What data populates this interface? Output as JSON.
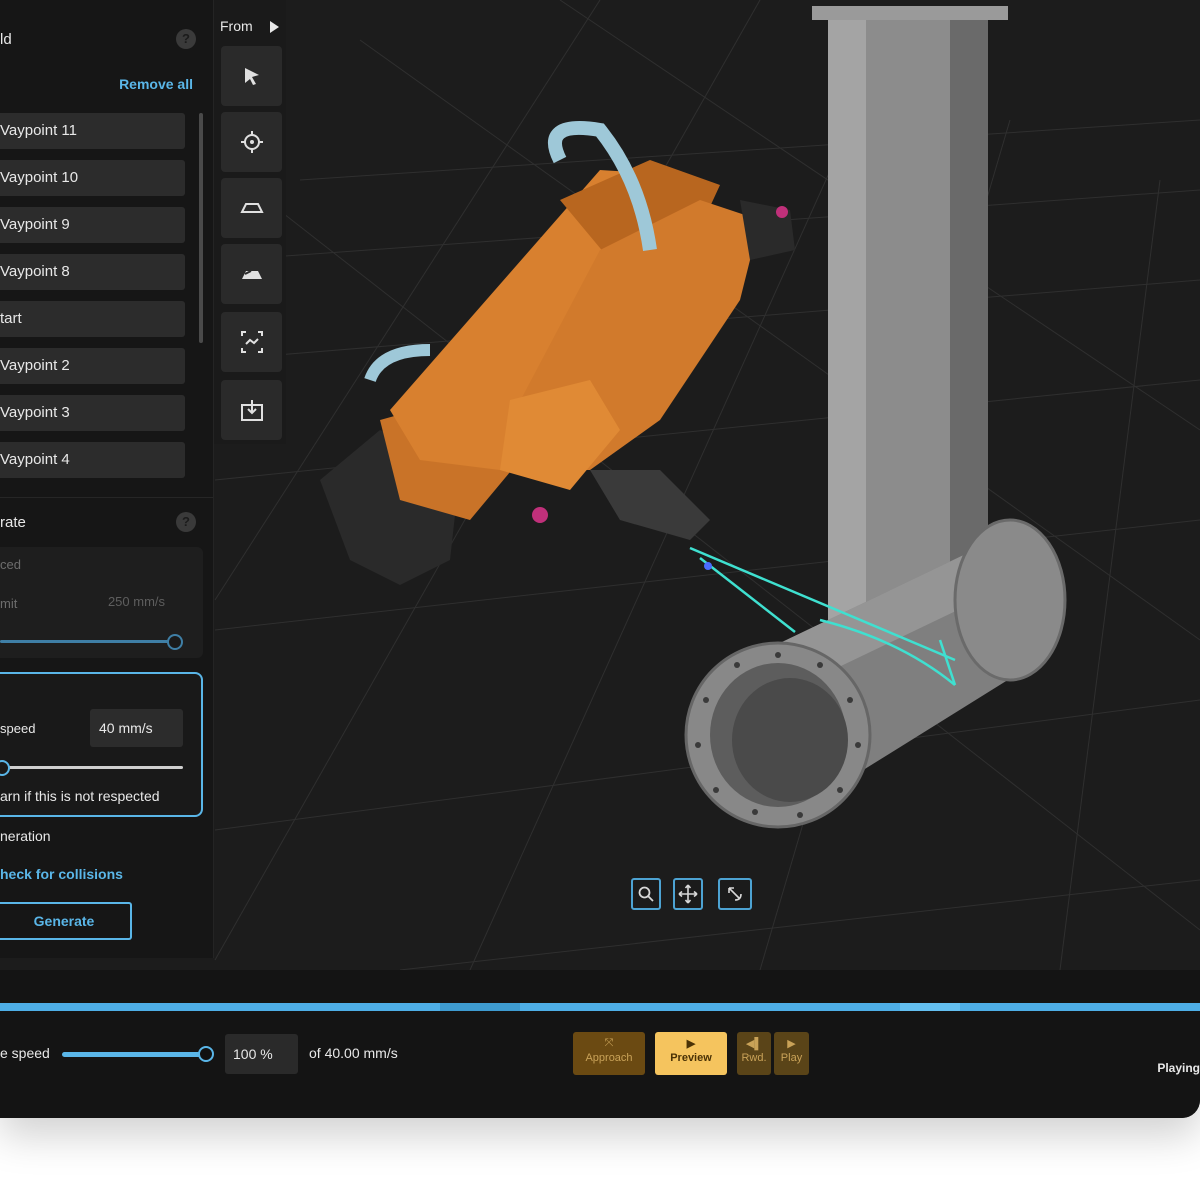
{
  "left_panel": {
    "path_section_title": "ld",
    "remove_all_label": "Remove all",
    "waypoints": [
      {
        "label": "Vaypoint 11"
      },
      {
        "label": "Vaypoint 10"
      },
      {
        "label": "Vaypoint 9"
      },
      {
        "label": "Vaypoint 8"
      },
      {
        "label": "tart"
      },
      {
        "label": "Vaypoint 2"
      },
      {
        "label": "Vaypoint 3"
      },
      {
        "label": "Vaypoint 4"
      }
    ],
    "generate_section_title": "rate",
    "speed_mode_label": "ced",
    "speed_limit_label": "mit",
    "speed_limit_value": "250 mm/s",
    "tcp_speed_label": "speed",
    "tcp_speed_value": "40 mm/s",
    "warn_label": "arn if this is not respected",
    "generation_label": "neration",
    "check_collisions_label": "heck for collisions",
    "generate_button": "Generate",
    "help_glyph": "?"
  },
  "toolbar": {
    "from_label": "From",
    "tools": [
      {
        "icon": "pointer-icon"
      },
      {
        "icon": "target-icon"
      },
      {
        "icon": "plane-outline-icon"
      },
      {
        "icon": "plane-filled-icon"
      },
      {
        "icon": "fit-view-icon"
      },
      {
        "icon": "download-icon"
      }
    ]
  },
  "view_controls": [
    {
      "icon": "zoom-icon"
    },
    {
      "icon": "pan-icon"
    },
    {
      "icon": "rotate-icon"
    }
  ],
  "playback": {
    "speed_label": "e speed",
    "speed_fraction": 1.0,
    "speed_value": "100 %",
    "speed_of": "of 40.00 mm/s",
    "buttons": [
      {
        "name": "approach",
        "label": "Approach",
        "glyph": "⤧"
      },
      {
        "name": "preview",
        "label": "Preview",
        "glyph": "▶"
      },
      {
        "name": "rwd",
        "label": "Rwd.",
        "glyph": "◀▌"
      },
      {
        "name": "play",
        "label": "Play",
        "glyph": "▶"
      }
    ],
    "status": "Playing"
  },
  "colors": {
    "accent": "#5ab6e8",
    "robot": "#d8802f",
    "pipe": "#8a8a8a",
    "path": "#3fe0d0",
    "preview_active": "#f5c45e",
    "approach": "#6b4a12"
  }
}
